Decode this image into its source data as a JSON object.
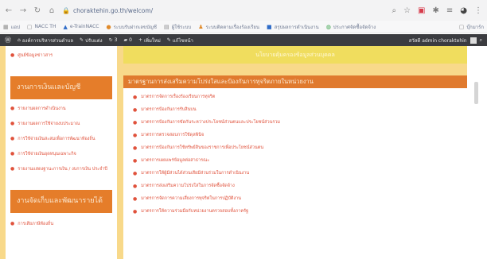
{
  "browser": {
    "url": "choraktehin.go.th/welcom/",
    "bookmarks": [
      "แอป",
      "NACC TH",
      "e-TrainNACC",
      "ระบบรับฝากเลขบัญชี",
      "ผู้ใช้ระบบ",
      "ระบบติดตามเรื่องร้องเรียน",
      "สรุปผลการดำเนินงาน",
      "ประกาศจัดซื้อจัดจ้าง"
    ],
    "bookmarks_right": "บุ๊กมาร์ก",
    "colors": {
      "accent": "#d63a4a"
    }
  },
  "wpbar": {
    "site_name": "องค์การบริหารส่วนตำบล",
    "customize": "ปรับแต่ง",
    "comment_count": "3",
    "updates_count": "0",
    "new_label": "เพิ่มใหม่",
    "edit_label": "แก้ไขหน้า",
    "greeting": "สวัสดี admin choraktehin"
  },
  "sidebar": {
    "top_item": "ศูนย์ข้อมูลข่าวสาร",
    "section1_title": "งานการเงินและบัญชี",
    "section1_items": [
      "รายงานผลการดำเนินงาน",
      "รายงานผลการใช้จ่ายงบประมาณ",
      "การใช้จ่ายเงินสะสมเพื่อการพัฒนาท้องถิ่น",
      "การใช้จ่ายเงินอุดหนุนเฉพาะกิจ",
      "รายงานแสดงฐานะการเงิน / งบการเงิน ประจำปี"
    ],
    "section2_title": "งานจัดเก็บและพัฒนารายได้",
    "section2_items": [
      "การเสียภาษีท้องถิ่น"
    ]
  },
  "main": {
    "top_banner": "นโยบายคุ้มครองข้อมูลส่วนบุคคล",
    "panel_title": "มาตรฐานการส่งเสริมความโปร่งใสและป้องกันการทุจริตภายในหน่วยงาน",
    "items": [
      "มาตรการจัดการเรื่องร้องเรียนการทุจริต",
      "มาตรการป้องกันการรับสินบน",
      "มาตรการป้องกันการขัดกันระหว่างประโยชน์ส่วนตนและประโยชน์ส่วนรวม",
      "มาตรการตรวจสอบการใช้ดุลพินิจ",
      "มาตรการป้องกันการใช้ทรัพย์สินของราชการเพื่อประโยชน์ส่วนตน",
      "มาตรการเผยแพร่ข้อมูลต่อสาธารณะ",
      "มาตรการให้ผู้มีส่วนได้ส่วนเสียมีส่วนร่วมในการดำเนินงาน",
      "มาตรการส่งเสริมความโปร่งใสในการจัดซื้อจัดจ้าง",
      "มาตรการจัดการความเสี่ยงการทุจริตในการปฏิบัติงาน",
      "มาตรการให้ความร่วมมือกับหน่วยงานตรวจสอบทั้งภาครัฐ"
    ]
  }
}
